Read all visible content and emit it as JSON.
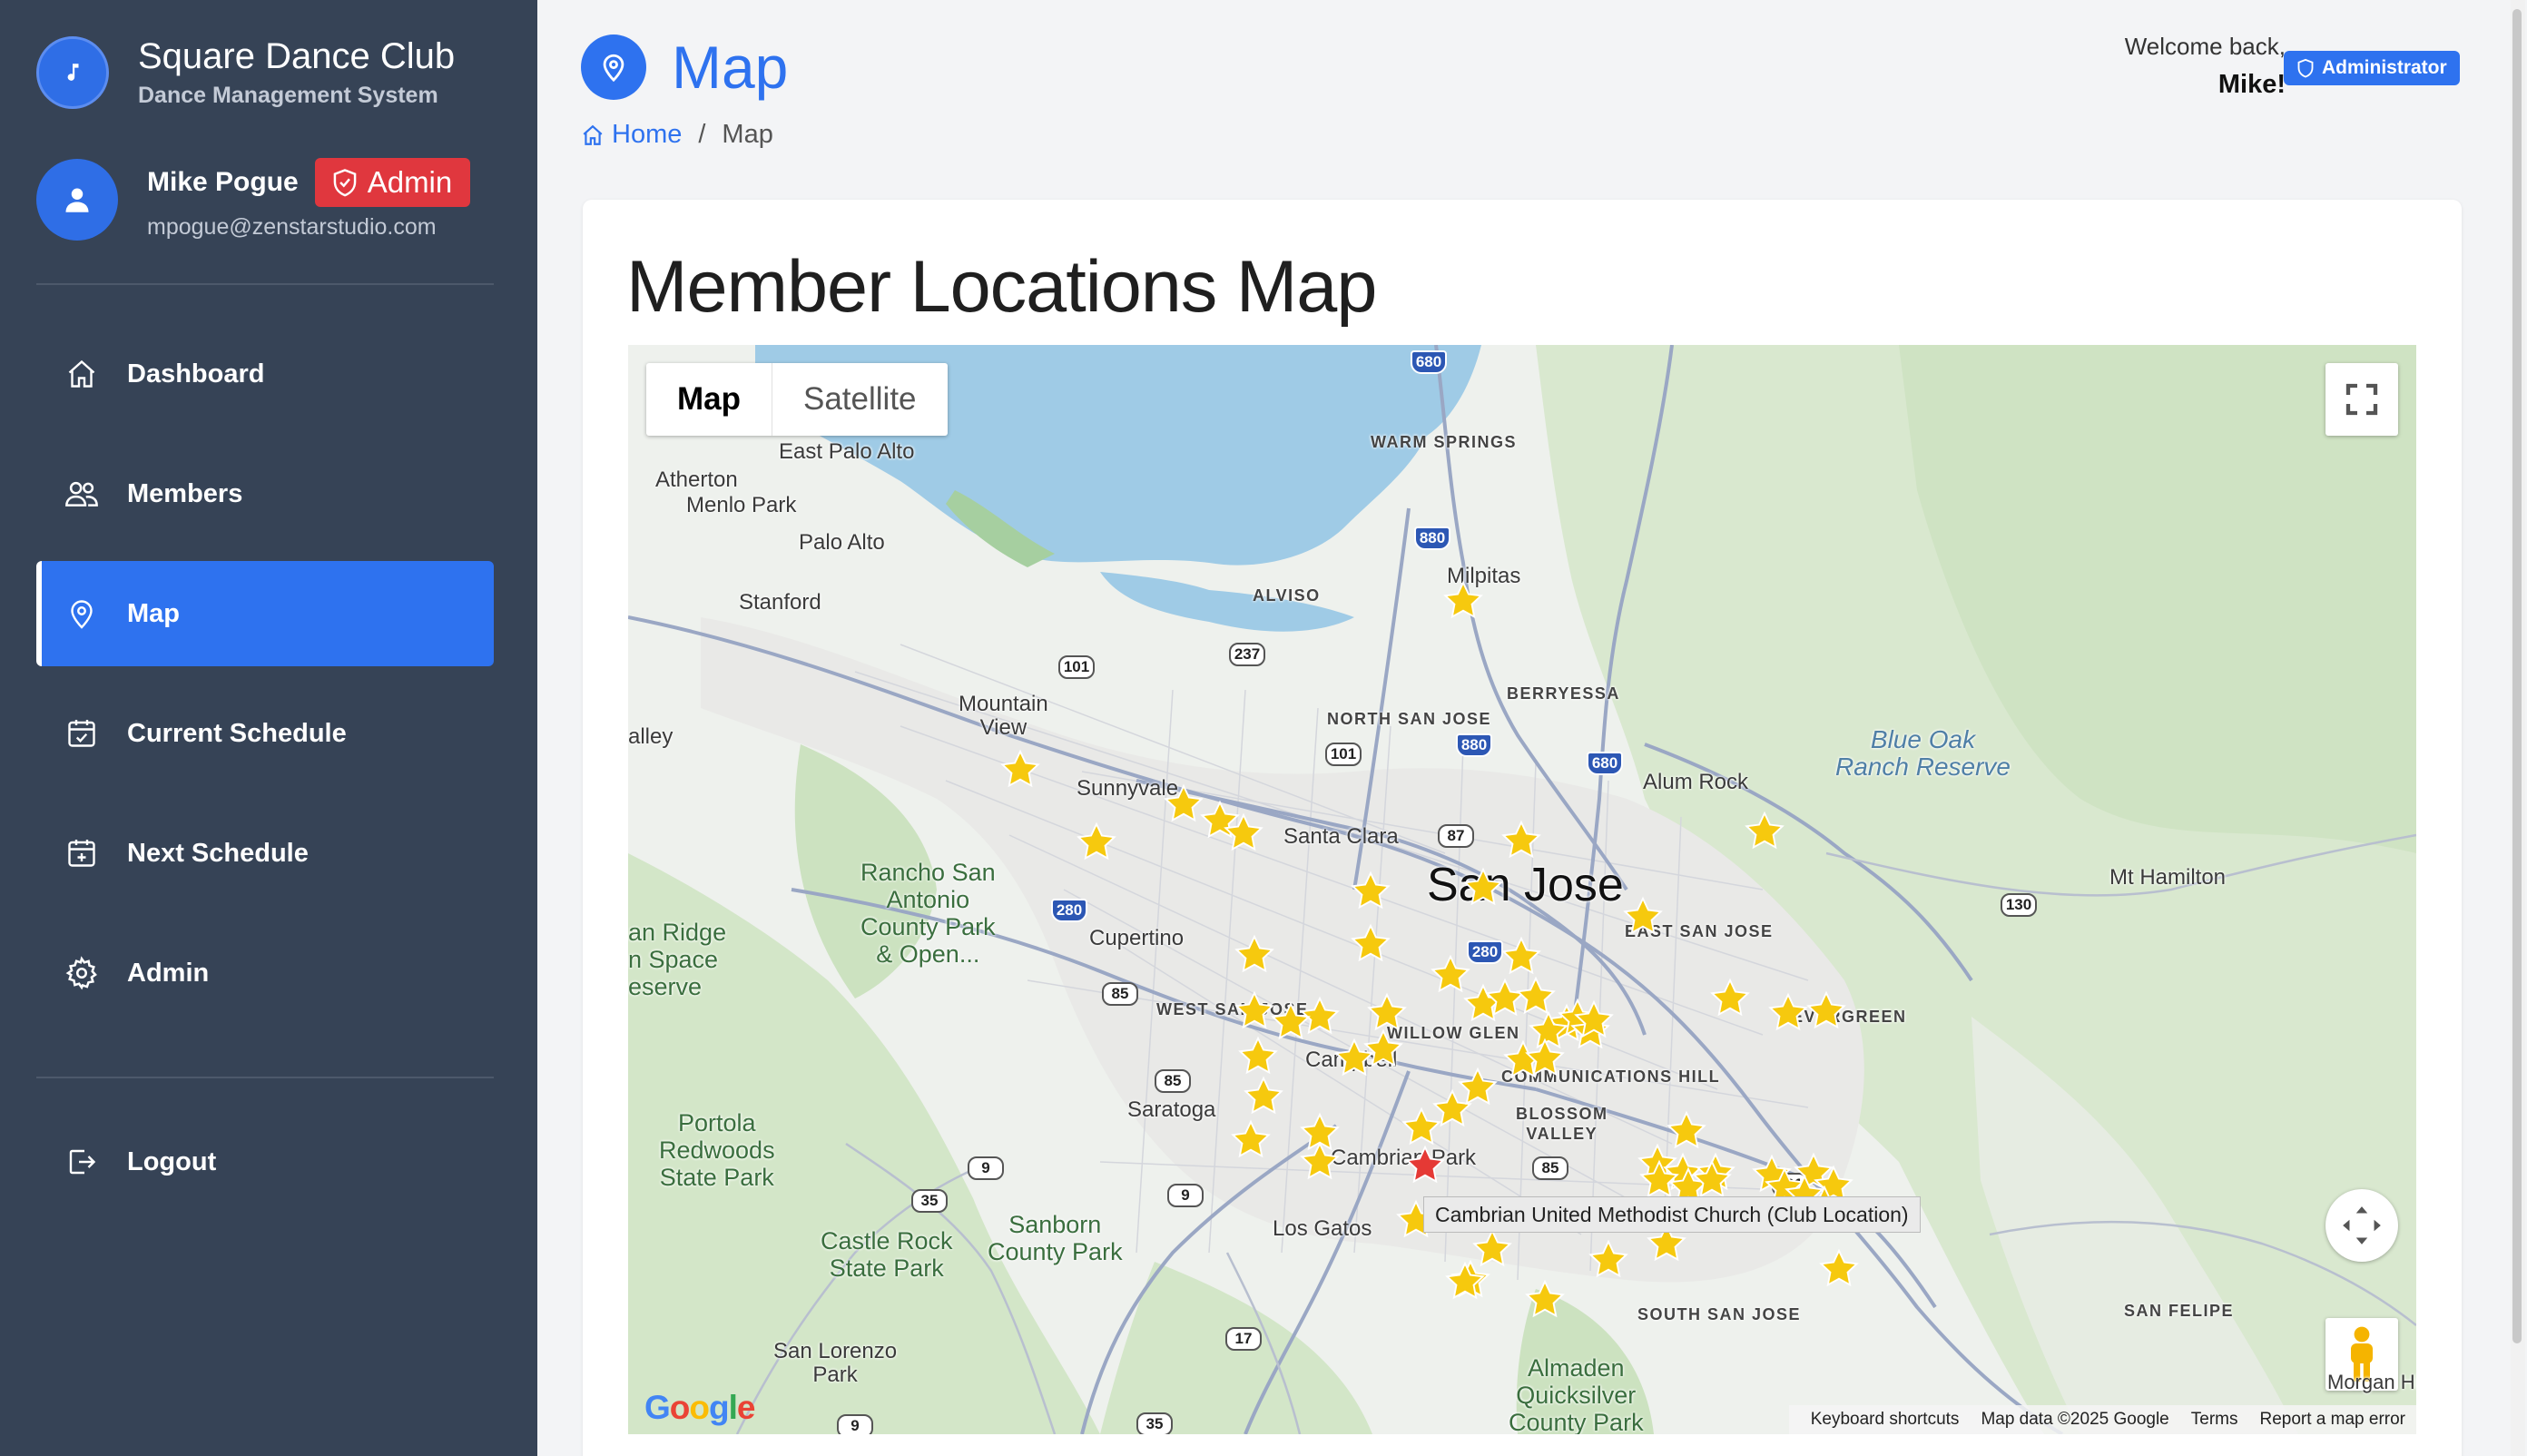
{
  "brand": {
    "title": "Square Dance Club",
    "subtitle": "Dance Management System",
    "icon": "music-note-icon"
  },
  "user": {
    "name": "Mike Pogue",
    "badge": "Admin",
    "email": "mpogue@zenstarstudio.com"
  },
  "nav": {
    "items": [
      {
        "label": "Dashboard",
        "icon": "home-icon"
      },
      {
        "label": "Members",
        "icon": "users-icon"
      },
      {
        "label": "Map",
        "icon": "map-pin-icon",
        "active": true
      },
      {
        "label": "Current Schedule",
        "icon": "calendar-check-icon"
      },
      {
        "label": "Next Schedule",
        "icon": "calendar-plus-icon"
      },
      {
        "label": "Admin",
        "icon": "gear-icon"
      }
    ],
    "logout": "Logout"
  },
  "header": {
    "title": "Map",
    "breadcrumb": {
      "home": "Home",
      "separator": "/",
      "current": "Map"
    },
    "welcome": "Welcome back,",
    "username": "Mike!",
    "role": "Administrator"
  },
  "card": {
    "title": "Member Locations Map"
  },
  "map": {
    "type_buttons": [
      "Map",
      "Satellite"
    ],
    "selected_type": "Map",
    "tooltip": "Cambrian United Methodist Church (Club Location)",
    "attribution": [
      "Keyboard shortcuts",
      "Map data ©2025 Google",
      "Terms",
      "Report a map error"
    ],
    "logo": "Google",
    "member_marker_color": "#f6c90e",
    "club_marker_color": "#e53935",
    "member_markers": 63,
    "places": {
      "san_jose": "San Jose",
      "warm_springs": "WARM SPRINGS",
      "east_palo_alto": "East Palo Alto",
      "atherton": "Atherton",
      "menlo_park": "Menlo Park",
      "palo_alto": "Palo Alto",
      "stanford": "Stanford",
      "alviso": "ALVISO",
      "milpitas": "Milpitas",
      "berryessa": "BERRYESSA",
      "north_san_jose": "NORTH SAN JOSE",
      "mountain_view": "Mountain\nView",
      "valley": "alley",
      "sunnyvale": "Sunnyvale",
      "santa_clara": "Santa Clara",
      "alum_rock": "Alum Rock",
      "blue_oak": "Blue Oak\nRanch Reserve",
      "mt_hamilton": "Mt Hamilton",
      "rancho": "Rancho San\nAntonio\nCounty Park\n& Open...",
      "ridge": "an Ridge\nn Space\neserve",
      "cupertino": "Cupertino",
      "east_san_jose": "EAST SAN JOSE",
      "west_san_jose": "WEST SAN JOSE",
      "willow_glen": "WILLOW GLEN",
      "evergreen": "EVERGREEN",
      "campbell": "Campbell",
      "communications_hill": "COMMUNICATIONS HILL",
      "saratoga": "Saratoga",
      "blossom_valley": "BLOSSOM\nVALLEY",
      "portola": "Portola\nRedwoods\nState Park",
      "cambrian_park": "Cambrian Park",
      "los_gatos": "Los Gatos",
      "sanborn": "Sanborn\nCounty Park",
      "castle_rock": "Castle Rock\nState Park",
      "south_san_jose": "SOUTH SAN JOSE",
      "san_felipe": "SAN FELIPE",
      "san_lorenzo": "San Lorenzo\nPark",
      "almaden": "Almaden\nQuicksilver\nCounty Park",
      "morgan_hill": "Morgan Hill"
    },
    "shields": [
      "680",
      "880",
      "237",
      "101",
      "880",
      "101",
      "680",
      "87",
      "280",
      "280",
      "130",
      "85",
      "85",
      "9",
      "35",
      "9",
      "85",
      "101",
      "17",
      "9",
      "35"
    ]
  }
}
